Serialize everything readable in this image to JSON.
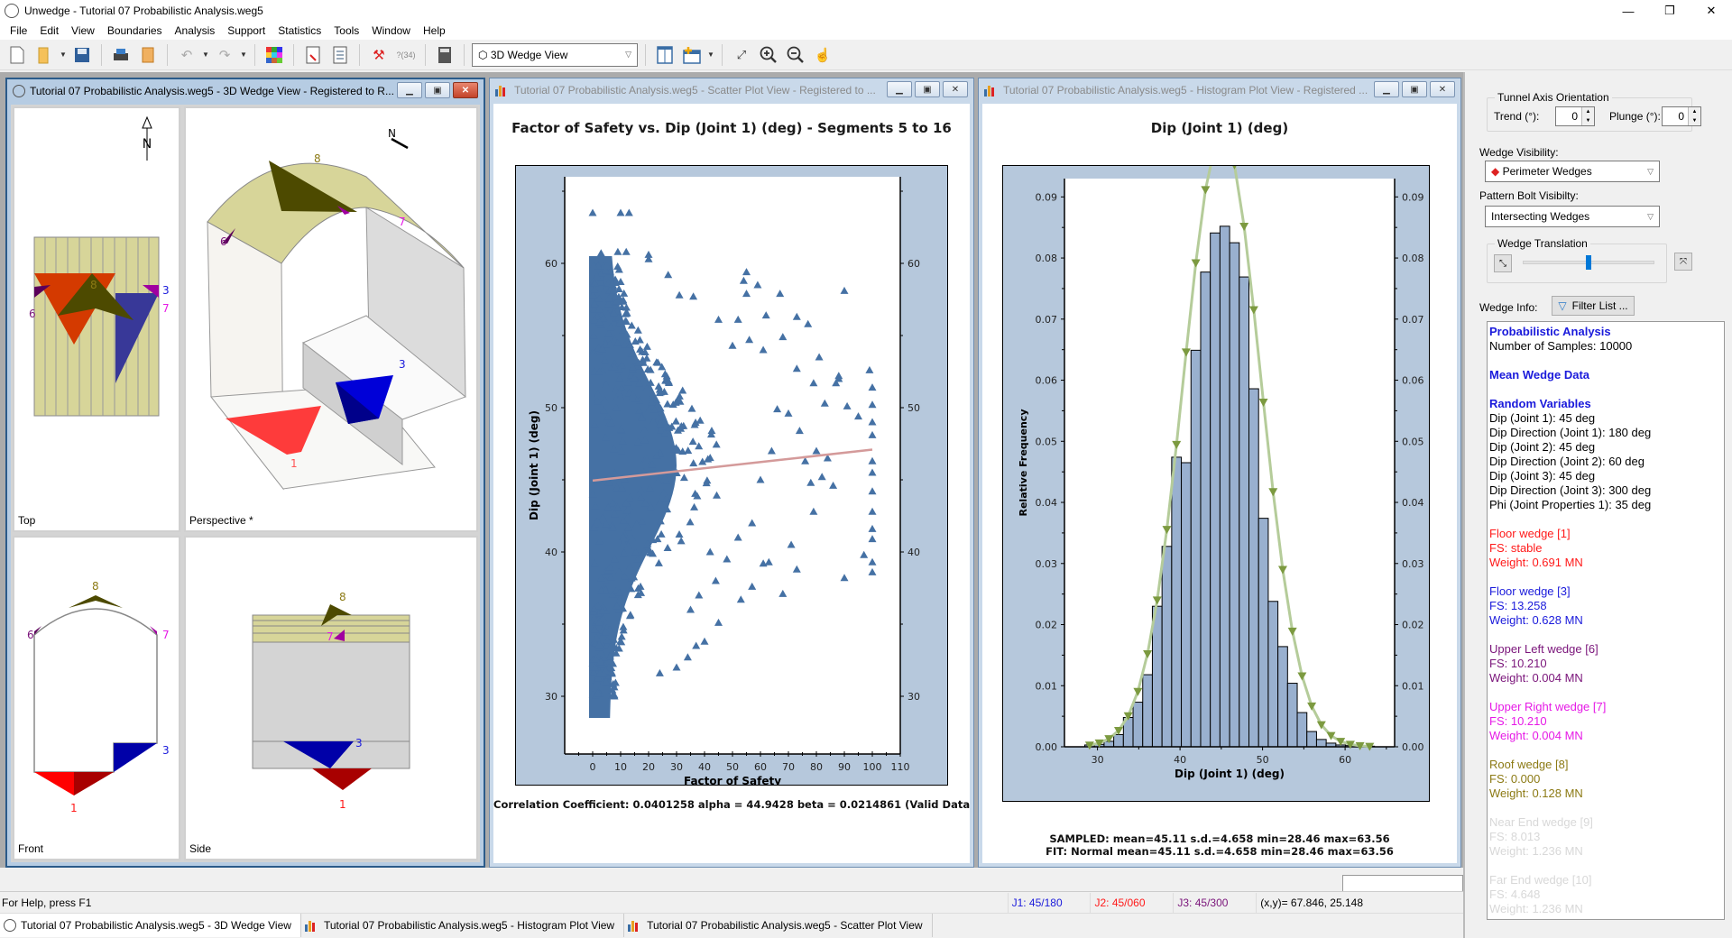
{
  "window": {
    "title": "Unwedge - Tutorial 07 Probabilistic Analysis.weg5",
    "minimize": "—",
    "restore": "❐",
    "close": "✕"
  },
  "menu": [
    "File",
    "Edit",
    "View",
    "Boundaries",
    "Analysis",
    "Support",
    "Statistics",
    "Tools",
    "Window",
    "Help"
  ],
  "toolbar": {
    "view_select": "3D Wedge View",
    "icons": [
      "new-file-icon",
      "open-folder-icon",
      "save-icon",
      "print-icon",
      "export-icon",
      "undo-icon",
      "redo-icon",
      "project-settings-icon",
      "input-data-icon",
      "joint-properties-icon",
      "compute-icon",
      "info-viewer-icon",
      "calculator-icon",
      "tile-vertical-icon",
      "new-window-icon",
      "zoom-extents-icon",
      "zoom-in-icon",
      "zoom-out-icon",
      "pan-icon"
    ]
  },
  "wedge_window": {
    "title": "Tutorial 07 Probabilistic Analysis.weg5 - 3D Wedge View - Registered to R...",
    "panes": {
      "top": "Top",
      "perspective": "Perspective *",
      "front": "Front",
      "side": "Side"
    },
    "north_label": "N",
    "wedge_labels": {
      "floor1": "1",
      "floor3": "3",
      "upper_left": "6",
      "upper_right": "7",
      "roof": "8"
    }
  },
  "scatter_window": {
    "title": "Tutorial 07 Probabilistic Analysis.weg5 - Scatter Plot View - Registered to ...",
    "footer": "Correlation Coefficient: 0.0401258 alpha = 44.9428 beta = 0.0214861 (Valid Data"
  },
  "histogram_window": {
    "title": "Tutorial 07 Probabilistic Analysis.weg5 - Histogram Plot View - Registered ...",
    "footer_sampled": "SAMPLED: mean=45.11 s.d.=4.658 min=28.46 max=63.56",
    "footer_fit": "FIT: Normal mean=45.11 s.d.=4.658 min=28.46 max=63.56"
  },
  "chart_data": [
    {
      "type": "scatter",
      "title": "Factor of Safety  vs. Dip (Joint 1) (deg) - Segments 5 to 16",
      "xlabel": "Factor of Safety",
      "ylabel": "Dip (Joint 1) (deg)",
      "xlim": [
        -10,
        110
      ],
      "ylim": [
        26,
        66
      ],
      "xticks": [
        0,
        10,
        20,
        30,
        40,
        50,
        60,
        70,
        80,
        90,
        100,
        110
      ],
      "yticks": [
        30,
        40,
        50,
        60
      ],
      "right_axis": true,
      "marker": "triangle",
      "color": "#4571a4",
      "regression": {
        "alpha": 44.9428,
        "beta": 0.0214861,
        "r": 0.0401258,
        "x_range": [
          0,
          100
        ],
        "color": "#d49a9a"
      },
      "n_samples": 10000,
      "outlier_points": [
        [
          0,
          63.5
        ],
        [
          10,
          63.5
        ],
        [
          13,
          63.5
        ],
        [
          3,
          60.7
        ],
        [
          9,
          60.8
        ],
        [
          12,
          60.8
        ],
        [
          20,
          60.6
        ],
        [
          20,
          60.3
        ],
        [
          27,
          59.2
        ],
        [
          31,
          57.8
        ],
        [
          36,
          57.7
        ],
        [
          55,
          59.4
        ],
        [
          54,
          58.8
        ],
        [
          59,
          58.5
        ],
        [
          55,
          57.9
        ],
        [
          67,
          57.9
        ],
        [
          90,
          58.1
        ],
        [
          52,
          56.1
        ],
        [
          45,
          56.1
        ],
        [
          62,
          56.4
        ],
        [
          73,
          56.3
        ],
        [
          77,
          55.8
        ],
        [
          61,
          54
        ],
        [
          68,
          54.9
        ],
        [
          50,
          54.3
        ],
        [
          56,
          54.7
        ],
        [
          81,
          53.5
        ],
        [
          73,
          52.7
        ],
        [
          79,
          51.7
        ],
        [
          83,
          50.3
        ],
        [
          87,
          51.7
        ],
        [
          88,
          52.2
        ],
        [
          91,
          50.1
        ],
        [
          88,
          52
        ],
        [
          95,
          49.4
        ],
        [
          99,
          52.6
        ],
        [
          100,
          51.4
        ],
        [
          100,
          50.2
        ],
        [
          100,
          49
        ],
        [
          100,
          48.1
        ],
        [
          100,
          46.3
        ],
        [
          100,
          45.5
        ],
        [
          100,
          44.2
        ],
        [
          100,
          42.8
        ],
        [
          100,
          41.6
        ],
        [
          100,
          40.9
        ],
        [
          100,
          39.3
        ],
        [
          100,
          38.6
        ],
        [
          97,
          39.8
        ],
        [
          90,
          38.2
        ],
        [
          73,
          38.8
        ],
        [
          68,
          37.1
        ],
        [
          57,
          37.6
        ],
        [
          53,
          36.7
        ],
        [
          45,
          35.1
        ],
        [
          40,
          33.8
        ],
        [
          37,
          33.5
        ],
        [
          34,
          32.7
        ],
        [
          30,
          32
        ],
        [
          24,
          31.6
        ],
        [
          78,
          44.8
        ],
        [
          82,
          45.2
        ],
        [
          86,
          44.6
        ],
        [
          79,
          42.8
        ],
        [
          71,
          40.5
        ],
        [
          63,
          39.3
        ],
        [
          61,
          39.2
        ],
        [
          76,
          46.3
        ],
        [
          80,
          47
        ],
        [
          84,
          46.5
        ],
        [
          74,
          48.4
        ],
        [
          66,
          49.9
        ],
        [
          70,
          49.6
        ],
        [
          64,
          47
        ],
        [
          60,
          45
        ],
        [
          57,
          42
        ],
        [
          52,
          41
        ],
        [
          48,
          39.5
        ],
        [
          44,
          38
        ],
        [
          42,
          40
        ],
        [
          38,
          37
        ],
        [
          35,
          36
        ]
      ],
      "dense_region": {
        "fs_range": [
          0,
          35
        ],
        "dip_range": [
          28.5,
          60.5
        ]
      }
    },
    {
      "type": "bar",
      "subtype": "histogram-with-fit",
      "title": "Dip (Joint 1) (deg)",
      "xlabel": "Dip (Joint 1) (deg)",
      "ylabel": "Relative Frequency",
      "xlim": [
        26,
        66
      ],
      "ylim": [
        0,
        0.093
      ],
      "xticks": [
        30,
        40,
        50,
        60
      ],
      "yticks": [
        0.0,
        0.01,
        0.02,
        0.03,
        0.04,
        0.05,
        0.06,
        0.07,
        0.08,
        0.09
      ],
      "right_axis": true,
      "bar_color": "#99b0cf",
      "bins_start": 28.46,
      "bin_width": 1.17,
      "values": [
        0.0003,
        0.0004,
        0.0009,
        0.002,
        0.0048,
        0.0073,
        0.0118,
        0.023,
        0.0328,
        0.0474,
        0.0465,
        0.0649,
        0.0777,
        0.0841,
        0.0852,
        0.0825,
        0.0769,
        0.0586,
        0.0374,
        0.0238,
        0.0164,
        0.0104,
        0.0056,
        0.0025,
        0.0012,
        0.0006,
        0.0003,
        0.0002,
        0.0001,
        0.0001
      ],
      "fit": {
        "name": "Normal",
        "mean": 45.11,
        "sd": 4.658,
        "color": "#b5cc9a",
        "marker_color": "#7c9a40"
      }
    }
  ],
  "side_panel": {
    "tunnel_axis": {
      "label": "Tunnel Axis Orientation",
      "trend_label": "Trend (°):",
      "trend": "0",
      "plunge_label": "Plunge (°):",
      "plunge": "0"
    },
    "wedge_visibility": {
      "label": "Wedge Visibility:",
      "value": "Perimeter Wedges"
    },
    "bolt_visibility": {
      "label": "Pattern Bolt Visibilty:",
      "value": "Intersecting Wedges"
    },
    "translation": {
      "label": "Wedge Translation",
      "slider_fraction": 0.5
    },
    "wedge_info_label": "Wedge Info:",
    "filter_button": "Filter List ...",
    "info": [
      {
        "text": "Probabilistic Analysis",
        "style": "h"
      },
      {
        "text": "Number of Samples: 10000",
        "color": "#000000"
      },
      {
        "text": "",
        "gap": true
      },
      {
        "text": "Mean Wedge Data",
        "style": "h"
      },
      {
        "text": "",
        "gap": true
      },
      {
        "text": "Random Variables",
        "style": "h"
      },
      {
        "text": "Dip (Joint 1): 45 deg",
        "color": "#000000"
      },
      {
        "text": "Dip Direction (Joint 1): 180 deg",
        "color": "#000000"
      },
      {
        "text": "Dip (Joint 2): 45 deg",
        "color": "#000000"
      },
      {
        "text": "Dip Direction (Joint 2): 60 deg",
        "color": "#000000"
      },
      {
        "text": "Dip (Joint 3): 45 deg",
        "color": "#000000"
      },
      {
        "text": "Dip Direction (Joint 3): 300 deg",
        "color": "#000000"
      },
      {
        "text": "Phi (Joint Properties 1): 35 deg",
        "color": "#000000"
      },
      {
        "text": "",
        "gap": true
      },
      {
        "text": "Floor wedge [1]",
        "color": "#ff1a1a"
      },
      {
        "text": "FS: stable",
        "color": "#ff1a1a"
      },
      {
        "text": "Weight: 0.691 MN",
        "color": "#ff1a1a"
      },
      {
        "text": "",
        "gap": true
      },
      {
        "text": "Floor wedge [3]",
        "color": "#1a1adb"
      },
      {
        "text": "FS: 13.258",
        "color": "#1a1adb"
      },
      {
        "text": "Weight: 0.628 MN",
        "color": "#1a1adb"
      },
      {
        "text": "",
        "gap": true
      },
      {
        "text": "Upper Left wedge [6]",
        "color": "#7a147a"
      },
      {
        "text": "FS: 10.210",
        "color": "#7a147a"
      },
      {
        "text": "Weight: 0.004 MN",
        "color": "#7a147a"
      },
      {
        "text": "",
        "gap": true
      },
      {
        "text": "Upper Right wedge [7]",
        "color": "#e619e6"
      },
      {
        "text": "FS: 10.210",
        "color": "#e619e6"
      },
      {
        "text": "Weight: 0.004 MN",
        "color": "#e619e6"
      },
      {
        "text": "",
        "gap": true
      },
      {
        "text": "Roof wedge [8]",
        "color": "#8c7a14"
      },
      {
        "text": "FS: 0.000",
        "color": "#8c7a14"
      },
      {
        "text": "Weight: 0.128 MN",
        "color": "#8c7a14"
      },
      {
        "text": "",
        "gap": true
      },
      {
        "text": "Near End wedge [9]",
        "color": "#d8d8d8"
      },
      {
        "text": "FS: 8.013",
        "color": "#d8d8d8"
      },
      {
        "text": "Weight: 1.236 MN",
        "color": "#d8d8d8"
      },
      {
        "text": "",
        "gap": true
      },
      {
        "text": "Far End wedge [10]",
        "color": "#d8d8d8"
      },
      {
        "text": "FS: 4.648",
        "color": "#d8d8d8"
      },
      {
        "text": "Weight: 1.236 MN",
        "color": "#d8d8d8"
      }
    ]
  },
  "statusbar": {
    "help": "For Help, press F1",
    "j1": "J1: 45/180",
    "j1_color": "#1a1adb",
    "j2": "J2: 45/060",
    "j2_color": "#ff1a1a",
    "j3": "J3: 45/300",
    "j3_color": "#7a147a",
    "coords": "(x,y)= 67.846, 25.148"
  },
  "taskbar": [
    {
      "label": "Tutorial 07 Probabilistic Analysis.weg5 - 3D Wedge View",
      "icon": "wedge-view-icon",
      "active": true
    },
    {
      "label": "Tutorial 07 Probabilistic Analysis.weg5 - Histogram Plot View",
      "icon": "histogram-icon",
      "active": false
    },
    {
      "label": "Tutorial 07 Probabilistic Analysis.weg5 - Scatter Plot View",
      "icon": "scatter-icon",
      "active": false
    }
  ]
}
